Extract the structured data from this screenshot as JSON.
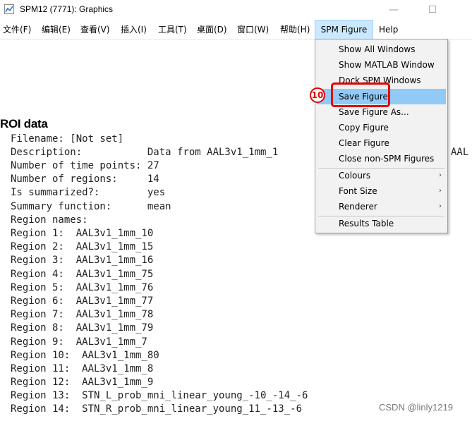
{
  "window": {
    "title": "SPM12 (7771): Graphics",
    "minimize_glyph": "—",
    "maximize_glyph": "☐"
  },
  "menubar": {
    "items": [
      {
        "label": "文件(F)"
      },
      {
        "label": "编辑(E)"
      },
      {
        "label": "查看(V)"
      },
      {
        "label": "插入(I)"
      },
      {
        "label": "工具(T)"
      },
      {
        "label": "桌面(D)"
      },
      {
        "label": "窗口(W)"
      },
      {
        "label": "帮助(H)"
      },
      {
        "label": "SPM Figure",
        "active": true
      },
      {
        "label": "Help"
      }
    ]
  },
  "dropdown": {
    "items": [
      {
        "label": "Show All Windows"
      },
      {
        "label": "Show MATLAB Window"
      },
      {
        "label": "Dock SPM Windows"
      },
      {
        "label": "Save Figure",
        "highlighted": true
      },
      {
        "label": "Save Figure As..."
      },
      {
        "label": "Copy Figure"
      },
      {
        "label": "Clear Figure"
      },
      {
        "label": "Close non-SPM Figures"
      },
      {
        "label": "Colours",
        "submenu": true
      },
      {
        "label": "Font Size",
        "submenu": true
      },
      {
        "label": "Renderer",
        "submenu": true
      },
      {
        "label": "Results Table"
      }
    ],
    "submenu_arrow": "›"
  },
  "annotation": {
    "badge": "10",
    "color": "#e60000"
  },
  "roi": {
    "heading": "ROI data",
    "lines": [
      "Filename: [Not set]",
      "Description:           Data from AAL3v1_1mm_1",
      "Number of time points: 27",
      "Number of regions:     14",
      "Is summarized?:        yes",
      "Summary function:      mean",
      "Region names:",
      "Region 1:  AAL3v1_1mm_10",
      "Region 2:  AAL3v1_1mm_15",
      "Region 3:  AAL3v1_1mm_16",
      "Region 4:  AAL3v1_1mm_75",
      "Region 5:  AAL3v1_1mm_76",
      "Region 6:  AAL3v1_1mm_77",
      "Region 7:  AAL3v1_1mm_78",
      "Region 8:  AAL3v1_1mm_79",
      "Region 9:  AAL3v1_1mm_7",
      "Region 10:  AAL3v1_1mm_80",
      "Region 11:  AAL3v1_1mm_8",
      "Region 12:  AAL3v1_1mm_9",
      "Region 13:  STN_L_prob_mni_linear_young_-10_-14_-6",
      "Region 14:  STN_R_prob_mni_linear_young_11_-13_-6"
    ],
    "overflow_text": "AAL"
  },
  "watermark": "CSDN @linly1219",
  "colors": {
    "menu_active_bg": "#cce8ff",
    "highlight_bg": "#91c9f7",
    "dropdown_bg": "#f2f2f2"
  }
}
